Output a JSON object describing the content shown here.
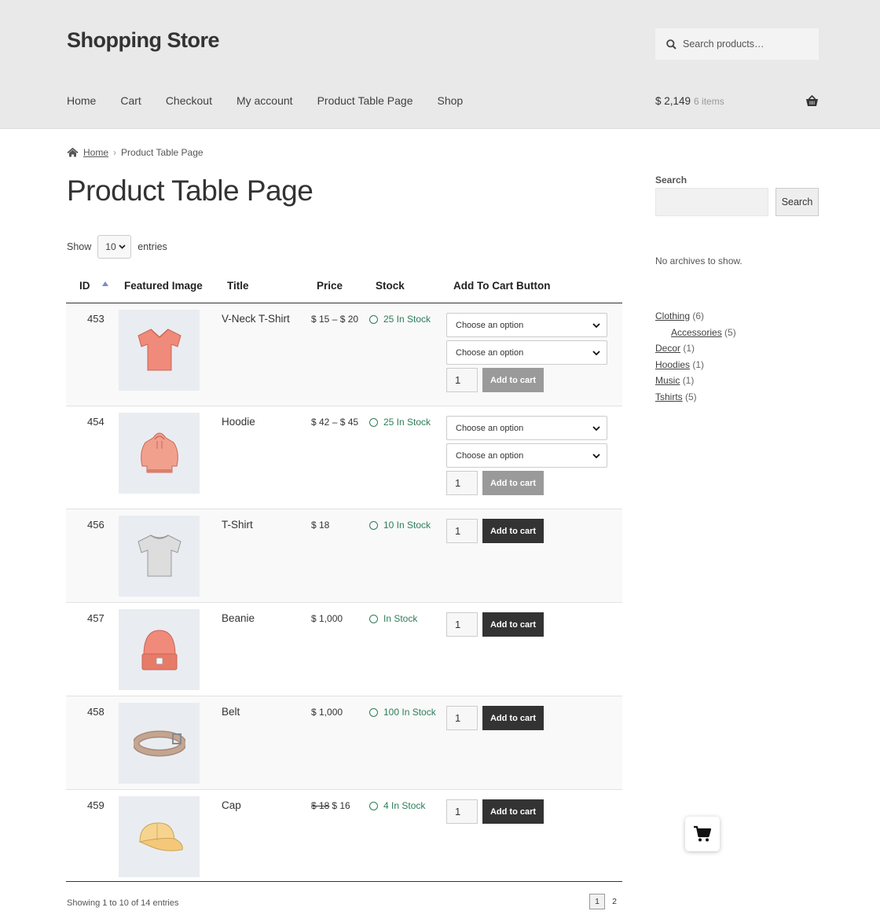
{
  "site": {
    "title": "Shopping Store"
  },
  "search_top": {
    "placeholder": "Search products…"
  },
  "nav": [
    "Home",
    "Cart",
    "Checkout",
    "My account",
    "Product Table Page",
    "Shop"
  ],
  "cart_summary": {
    "total": "$ 2,149",
    "items": "6 items"
  },
  "breadcrumb": {
    "home": "Home",
    "current": "Product Table Page"
  },
  "page_title": "Product Table Page",
  "length_menu": {
    "show": "Show",
    "value": "10",
    "entries": "entries"
  },
  "table": {
    "headers": [
      "ID",
      "Featured Image",
      "Title",
      "Price",
      "Stock",
      "Add To Cart Button"
    ],
    "rows": [
      {
        "id": "453",
        "title": "V-Neck T-Shirt",
        "price": "$ 15 – $ 20",
        "stock": "25 In Stock",
        "options": [
          "Choose an option",
          "Choose an option"
        ],
        "qty": "1",
        "button": "Add to cart",
        "button_disabled": true,
        "image": "vneck-tshirt"
      },
      {
        "id": "454",
        "title": "Hoodie",
        "price": "$ 42 – $ 45",
        "stock": "25 In Stock",
        "options": [
          "Choose an option",
          "Choose an option"
        ],
        "qty": "1",
        "button": "Add to cart",
        "button_disabled": true,
        "image": "hoodie"
      },
      {
        "id": "456",
        "title": "T-Shirt",
        "price": "$ 18",
        "stock": "10 In Stock",
        "qty": "1",
        "button": "Add to cart",
        "button_disabled": false,
        "image": "tshirt"
      },
      {
        "id": "457",
        "title": "Beanie",
        "price": "$ 1,000",
        "stock": "In Stock",
        "qty": "1",
        "button": "Add to cart",
        "button_disabled": false,
        "image": "beanie"
      },
      {
        "id": "458",
        "title": "Belt",
        "price": "$ 1,000",
        "stock": "100 In Stock",
        "qty": "1",
        "button": "Add to cart",
        "button_disabled": false,
        "image": "belt"
      },
      {
        "id": "459",
        "title": "Cap",
        "price_old": "$ 18",
        "price": "$ 16",
        "stock": "4 In Stock",
        "qty": "1",
        "button": "Add to cart",
        "button_disabled": false,
        "image": "cap"
      }
    ]
  },
  "table_info": "Showing 1 to 10 of 14 entries",
  "pagination": {
    "current": "1",
    "next": "2"
  },
  "sidebar": {
    "search_label": "Search",
    "search_button": "Search",
    "archives_text": "No archives to show.",
    "categories": [
      {
        "name": "Clothing",
        "count": "(6)",
        "sub": false
      },
      {
        "name": "Accessories",
        "count": "(5)",
        "sub": true
      },
      {
        "name": "Decor",
        "count": "(1)",
        "sub": false
      },
      {
        "name": "Hoodies",
        "count": "(1)",
        "sub": false
      },
      {
        "name": "Music",
        "count": "(1)",
        "sub": false
      },
      {
        "name": "Tshirts",
        "count": "(5)",
        "sub": false
      }
    ]
  },
  "colors": {
    "header_bg": "#e9e9e9",
    "stock_green": "#2e7d5a",
    "button_dark": "#333333",
    "button_disabled": "#9a9a9a",
    "sort_arrow": "#7b87d6"
  },
  "icons": {
    "search": "search-icon",
    "basket": "basket-icon",
    "home": "home-icon",
    "float_cart": "cart-icon"
  }
}
